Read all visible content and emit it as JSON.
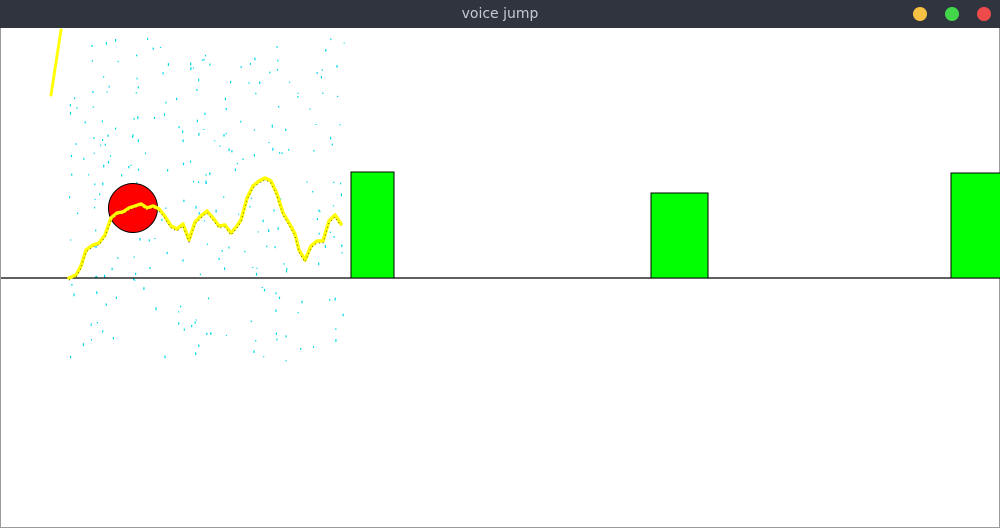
{
  "window": {
    "title": "voice jump",
    "controls": [
      {
        "name": "minimize-button",
        "color": "#f7c244"
      },
      {
        "name": "maximize-button",
        "color": "#43d54a"
      },
      {
        "name": "close-button",
        "color": "#f04b4b"
      }
    ]
  },
  "game": {
    "colors": {
      "background": "#ffffff",
      "ground": "#000000",
      "obstacle": "#00ff00",
      "obstacle_border": "#000000",
      "player": "#ff0000",
      "voice_trace": "#ffff00",
      "particles": "#00d8e8"
    },
    "player": "red-ball",
    "obstacle_count": 3
  }
}
